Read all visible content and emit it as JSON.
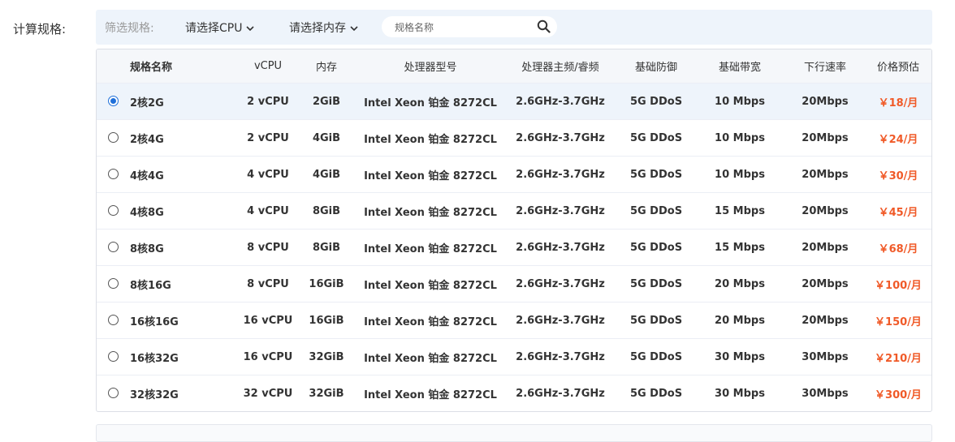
{
  "form": {
    "label": "计算规格:"
  },
  "filter": {
    "label": "筛选规格:",
    "cpu_select": "请选择CPU",
    "mem_select": "请选择内存",
    "search_placeholder": "规格名称",
    "search_icon": "search-icon",
    "chevron_icon": "chevron-down-icon"
  },
  "table": {
    "headers": [
      "规格名称",
      "vCPU",
      "内存",
      "处理器型号",
      "处理器主频/睿频",
      "基础防御",
      "基础带宽",
      "下行速率",
      "价格预估"
    ],
    "selected_index": 0,
    "rows": [
      [
        "2核2G",
        "2 vCPU",
        "2GiB",
        "Intel Xeon 铂金 8272CL",
        "2.6GHz-3.7GHz",
        "5G DDoS",
        "10 Mbps",
        "20Mbps",
        "￥18/月"
      ],
      [
        "2核4G",
        "2 vCPU",
        "4GiB",
        "Intel Xeon 铂金 8272CL",
        "2.6GHz-3.7GHz",
        "5G DDoS",
        "10 Mbps",
        "20Mbps",
        "￥24/月"
      ],
      [
        "4核4G",
        "4 vCPU",
        "4GiB",
        "Intel Xeon 铂金 8272CL",
        "2.6GHz-3.7GHz",
        "5G DDoS",
        "10 Mbps",
        "20Mbps",
        "￥30/月"
      ],
      [
        "4核8G",
        "4 vCPU",
        "8GiB",
        "Intel Xeon 铂金 8272CL",
        "2.6GHz-3.7GHz",
        "5G DDoS",
        "15 Mbps",
        "20Mbps",
        "￥45/月"
      ],
      [
        "8核8G",
        "8 vCPU",
        "8GiB",
        "Intel Xeon 铂金 8272CL",
        "2.6GHz-3.7GHz",
        "5G DDoS",
        "15 Mbps",
        "20Mbps",
        "￥68/月"
      ],
      [
        "8核16G",
        "8 vCPU",
        "16GiB",
        "Intel Xeon 铂金 8272CL",
        "2.6GHz-3.7GHz",
        "5G DDoS",
        "20 Mbps",
        "20Mbps",
        "￥100/月"
      ],
      [
        "16核16G",
        "16 vCPU",
        "16GiB",
        "Intel Xeon 铂金 8272CL",
        "2.6GHz-3.7GHz",
        "5G DDoS",
        "20 Mbps",
        "20Mbps",
        "￥150/月"
      ],
      [
        "16核32G",
        "16 vCPU",
        "32GiB",
        "Intel Xeon 铂金 8272CL",
        "2.6GHz-3.7GHz",
        "5G DDoS",
        "30 Mbps",
        "30Mbps",
        "￥210/月"
      ],
      [
        "32核32G",
        "32 vCPU",
        "32GiB",
        "Intel Xeon 铂金 8272CL",
        "2.6GHz-3.7GHz",
        "5G DDoS",
        "30 Mbps",
        "30Mbps",
        "￥300/月"
      ]
    ]
  },
  "colors": {
    "accent": "#1e6fd9",
    "price": "#f05a28",
    "filter_bg": "#eef4fb"
  }
}
